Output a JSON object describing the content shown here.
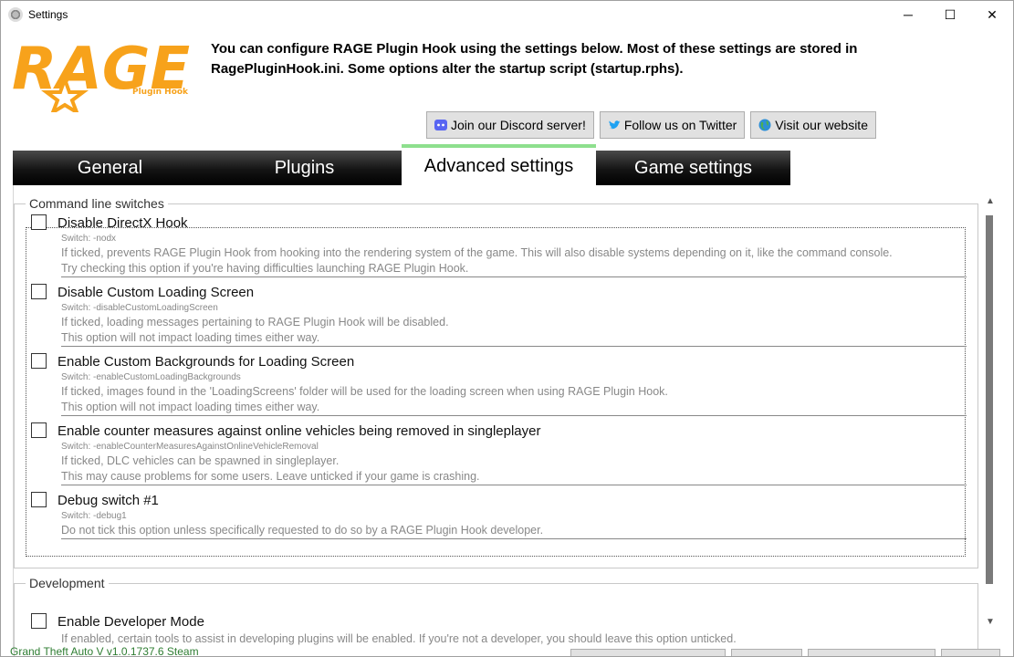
{
  "window": {
    "title": "Settings",
    "minimize": "─",
    "maximize": "☐",
    "close": "✕"
  },
  "logo": {
    "text": "RAGE",
    "subtext": "Plugin Hook"
  },
  "intro_line1": "You can configure RAGE Plugin Hook using the settings below. Most of these settings are stored in",
  "intro_line2": "RagePluginHook.ini. Some options alter the startup script (startup.rphs).",
  "links": {
    "discord": "Join our Discord server!",
    "twitter": "Follow us on Twitter",
    "website": "Visit our website"
  },
  "tabs": [
    "General",
    "Plugins",
    "Advanced settings",
    "Game settings"
  ],
  "groups": {
    "command_line": {
      "legend": "Command line switches",
      "options": [
        {
          "title": "Disable DirectX Hook",
          "switch": "Switch: -nodx",
          "desc1": "If ticked, prevents RAGE Plugin Hook from hooking into the rendering system of the game. This will also disable systems depending on it, like the command console.",
          "desc2": "Try checking this option if you're having difficulties launching RAGE Plugin Hook."
        },
        {
          "title": "Disable Custom Loading Screen",
          "switch": "Switch: -disableCustomLoadingScreen",
          "desc1": "If ticked, loading messages pertaining to RAGE Plugin Hook will be disabled.",
          "desc2": "This option will not impact loading times either way."
        },
        {
          "title": "Enable Custom Backgrounds for Loading Screen",
          "switch": "Switch: -enableCustomLoadingBackgrounds",
          "desc1": "If ticked, images found in the 'LoadingScreens' folder will be used for the loading screen when using RAGE Plugin Hook.",
          "desc2": "This option will not impact loading times either way."
        },
        {
          "title": "Enable counter measures against online vehicles being removed in singleplayer",
          "switch": "Switch: -enableCounterMeasuresAgainstOnlineVehicleRemoval",
          "desc1": "If ticked, DLC vehicles can be spawned in singleplayer.",
          "desc2": "This may cause problems for some users. Leave unticked if your game is crashing."
        },
        {
          "title": "Debug switch #1",
          "switch": "Switch: -debug1",
          "desc1": "Do not tick this option unless specifically requested to do so by a RAGE Plugin Hook developer.",
          "desc2": ""
        }
      ]
    },
    "development": {
      "legend": "Development",
      "option_title": "Enable Developer Mode",
      "option_desc": "If enabled, certain tools to assist in developing plugins will be enabled. If you're not a developer, you should leave this option unticked."
    }
  },
  "status": "Grand Theft Auto V v1.0.1737.6 Steam",
  "colors": {
    "logo_orange": "#f7a21b",
    "active_tab_accent": "#8ee08e",
    "status_green": "#2e7d32"
  }
}
